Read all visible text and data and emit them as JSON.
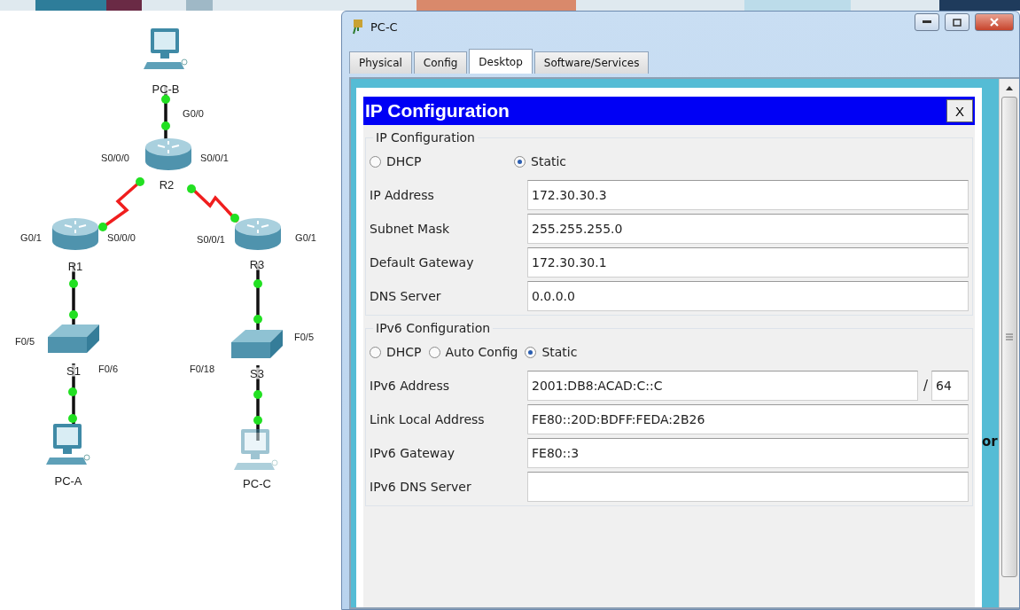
{
  "topology": {
    "nodes": [
      {
        "label": "PC-B",
        "kind": "pc",
        "selected": false
      },
      {
        "label": "R2",
        "kind": "router",
        "selected": false,
        "ports": [
          "G0/0",
          "S0/0/0",
          "S0/0/1"
        ]
      },
      {
        "label": "R1",
        "kind": "router",
        "selected": false,
        "ports": [
          "G0/1",
          "S0/0/0"
        ]
      },
      {
        "label": "R3",
        "kind": "router",
        "selected": false,
        "ports": [
          "S0/0/1",
          "G0/1"
        ]
      },
      {
        "label": "S1",
        "kind": "switch",
        "selected": false,
        "ports": [
          "F0/5",
          "F0/6"
        ]
      },
      {
        "label": "S3",
        "kind": "switch",
        "selected": false,
        "ports": [
          "F0/5",
          "F0/18"
        ]
      },
      {
        "label": "PC-A",
        "kind": "pc",
        "selected": false
      },
      {
        "label": "PC-C",
        "kind": "pc",
        "selected": true
      }
    ],
    "links": [
      {
        "kind": "ethernet"
      },
      {
        "kind": "serial"
      },
      {
        "kind": "serial"
      },
      {
        "kind": "ethernet"
      },
      {
        "kind": "ethernet"
      },
      {
        "kind": "ethernet"
      },
      {
        "kind": "ethernet"
      }
    ]
  },
  "window": {
    "title": "PC-C"
  },
  "tabs": [
    {
      "label": "Physical",
      "selected": false
    },
    {
      "label": "Config",
      "selected": false
    },
    {
      "label": "Desktop",
      "selected": true
    },
    {
      "label": "Software/Services",
      "selected": false
    }
  ],
  "background_fragment": "or",
  "dialog": {
    "title": "IP Configuration",
    "close": "X",
    "ipv4": {
      "legend": "IP Configuration",
      "modes": [
        {
          "label": "DHCP",
          "selected": false
        },
        {
          "label": "Static",
          "selected": true
        }
      ],
      "fields": [
        {
          "label": "IP Address",
          "value": "172.30.30.3"
        },
        {
          "label": "Subnet Mask",
          "value": "255.255.255.0"
        },
        {
          "label": "Default Gateway",
          "value": "172.30.30.1"
        },
        {
          "label": "DNS Server",
          "value": "0.0.0.0"
        }
      ]
    },
    "ipv6": {
      "legend": "IPv6 Configuration",
      "modes": [
        {
          "label": "DHCP",
          "selected": false
        },
        {
          "label": "Auto Config",
          "selected": false
        },
        {
          "label": "Static",
          "selected": true
        }
      ],
      "fields": [
        {
          "label": "IPv6 Address",
          "value": "2001:DB8:ACAD:C::C",
          "separator": "/",
          "prefix": "64"
        },
        {
          "label": "Link Local Address",
          "value": "FE80::20D:BDFF:FEDA:2B26"
        },
        {
          "label": "IPv6 Gateway",
          "value": "FE80::3"
        },
        {
          "label": "IPv6 DNS Server"
        }
      ]
    }
  }
}
